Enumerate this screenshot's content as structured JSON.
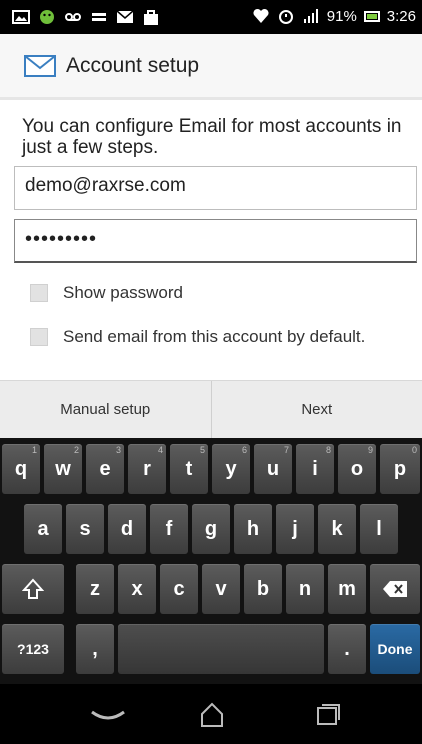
{
  "status_bar": {
    "battery": "91%",
    "time": "3:26"
  },
  "app": {
    "title": "Account setup",
    "intro": "You can configure Email for most accounts in just a few steps.",
    "email_value": "demo@raxrse.com",
    "password_value": "•••••••••",
    "show_password_label": "Show password",
    "default_account_label": "Send email from this account by default.",
    "manual_setup_label": "Manual setup",
    "next_label": "Next"
  },
  "keyboard": {
    "row1": [
      {
        "key": "q",
        "hint": "1"
      },
      {
        "key": "w",
        "hint": "2"
      },
      {
        "key": "e",
        "hint": "3"
      },
      {
        "key": "r",
        "hint": "4"
      },
      {
        "key": "t",
        "hint": "5"
      },
      {
        "key": "y",
        "hint": "6"
      },
      {
        "key": "u",
        "hint": "7"
      },
      {
        "key": "i",
        "hint": "8"
      },
      {
        "key": "o",
        "hint": "9"
      },
      {
        "key": "p",
        "hint": "0"
      }
    ],
    "row2": [
      "a",
      "s",
      "d",
      "f",
      "g",
      "h",
      "j",
      "k",
      "l"
    ],
    "row3": [
      "z",
      "x",
      "c",
      "v",
      "b",
      "n",
      "m"
    ],
    "symbols_label": "?123",
    "comma": ",",
    "period": ".",
    "done_label": "Done"
  }
}
